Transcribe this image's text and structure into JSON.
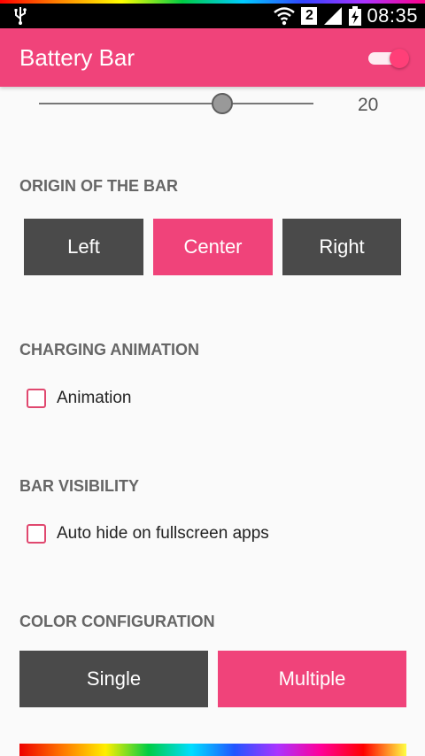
{
  "status_bar": {
    "sim_slot": "2",
    "time": "08:35",
    "icons": [
      "usb-icon",
      "wifi-icon",
      "signal-icon",
      "battery-icon"
    ]
  },
  "app_bar": {
    "title": "Battery Bar",
    "enabled": true
  },
  "thickness_slider": {
    "value": 20,
    "min": 0,
    "max": 30,
    "value_label": "20"
  },
  "origin_section": {
    "title": "ORIGIN OF THE BAR",
    "options": [
      "Left",
      "Center",
      "Right"
    ],
    "selected": "Center"
  },
  "charging_section": {
    "title": "CHARGING ANIMATION",
    "checkbox_label": "Animation",
    "checked": false
  },
  "visibility_section": {
    "title": "BAR VISIBILITY",
    "checkbox_label": "Auto hide on fullscreen apps",
    "checked": false
  },
  "color_section": {
    "title": "COLOR CONFIGURATION",
    "options": [
      "Single",
      "Multiple"
    ],
    "selected": "Multiple"
  },
  "colors": {
    "accent": "#f0437a",
    "button_inactive": "#4a4a4a",
    "section_title": "#666666"
  }
}
